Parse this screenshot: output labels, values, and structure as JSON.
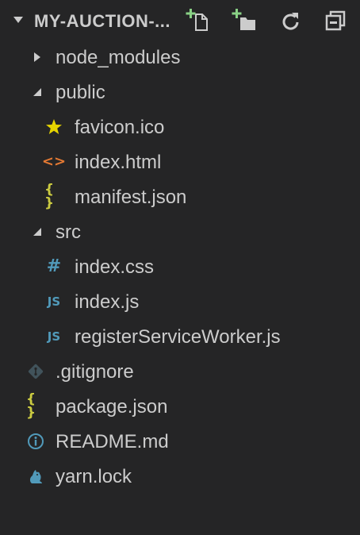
{
  "explorer": {
    "folder_title": "MY-AUCTION-...",
    "actions": [
      "new-file-icon",
      "new-folder-icon",
      "refresh-icon",
      "collapse-all-icon"
    ],
    "colors": {
      "background": "#252526",
      "text": "#cccccc",
      "action_plus": "#89d185",
      "star": "#e6d400",
      "html": "#e37933",
      "json": "#cbcb41",
      "css_js": "#519aba",
      "git": "#41535b",
      "info": "#519aba"
    }
  },
  "tree": {
    "node_modules": "node_modules",
    "public": "public",
    "favicon": "favicon.ico",
    "index_html": "index.html",
    "manifest": "manifest.json",
    "src": "src",
    "index_css": "index.css",
    "index_js": "index.js",
    "register_sw": "registerServiceWorker.js",
    "gitignore": ".gitignore",
    "package_json": "package.json",
    "readme": "README.md",
    "yarn_lock": "yarn.lock"
  },
  "glyphs": {
    "html": "<>",
    "json": "{ }",
    "css": "#",
    "js": "JS"
  }
}
